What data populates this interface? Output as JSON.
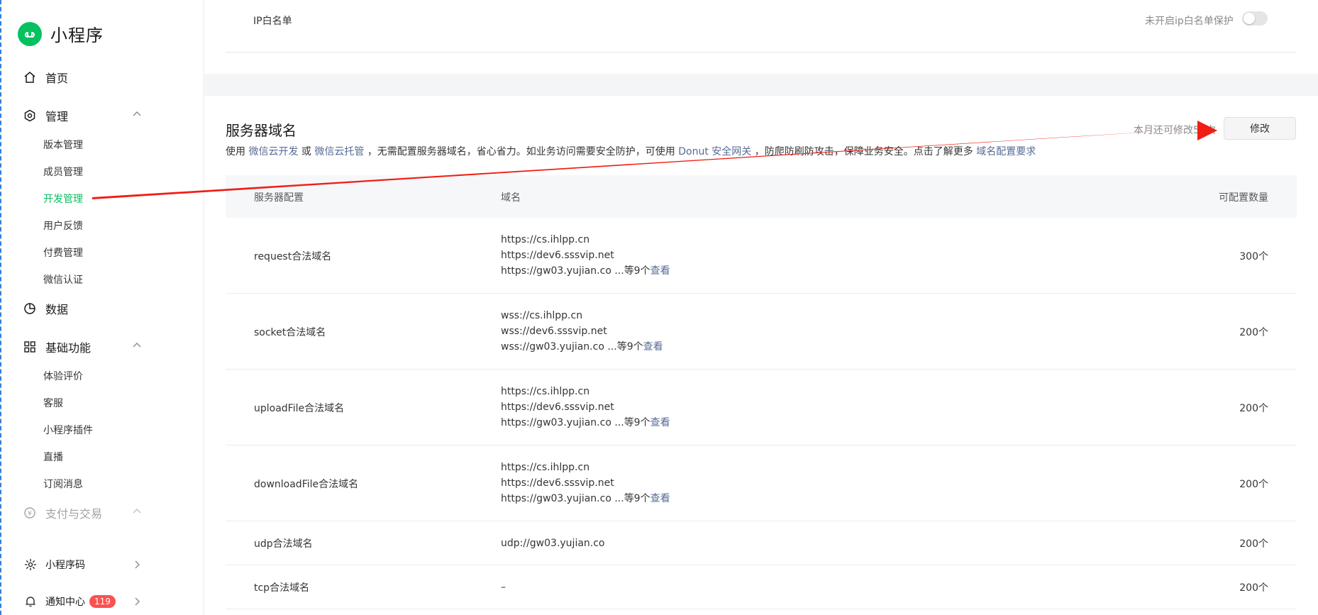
{
  "app": {
    "title": "小程序"
  },
  "sidebar": {
    "home": "首页",
    "manage": {
      "label": "管理",
      "items": [
        {
          "label": "版本管理",
          "active": false
        },
        {
          "label": "成员管理",
          "active": false
        },
        {
          "label": "开发管理",
          "active": true
        },
        {
          "label": "用户反馈",
          "active": false
        },
        {
          "label": "付费管理",
          "active": false
        },
        {
          "label": "微信认证",
          "active": false
        }
      ]
    },
    "data": "数据",
    "basic": {
      "label": "基础功能",
      "items": [
        {
          "label": "体验评价"
        },
        {
          "label": "客服"
        },
        {
          "label": "小程序插件"
        },
        {
          "label": "直播"
        },
        {
          "label": "订阅消息"
        }
      ]
    },
    "payment": "支付与交易",
    "qrcode": "小程序码",
    "notify": {
      "label": "通知中心",
      "badge": "119"
    }
  },
  "ip_whitelist": {
    "label": "IP白名单",
    "status": "未开启ip白名单保护",
    "enabled": false
  },
  "server_domain": {
    "title": "服务器域名",
    "desc": {
      "t1": "使用",
      "link1": "微信云开发",
      "t2": "或",
      "link2": "微信云托管",
      "t3": "，无需配置服务器域名，省心省力。如业务访问需要安全防护，可使用",
      "link3": "Donut 安全网关",
      "t4": "，防爬防刷防攻击，保障业务安全。点击了解更多",
      "link4": "域名配置要求"
    },
    "remain": "本月还可修改50次",
    "edit_label": "修改",
    "columns": [
      "服务器配置",
      "域名",
      "可配置数量"
    ],
    "rows": [
      {
        "name": "request合法域名",
        "domains": [
          "https://cs.ihlpp.cn",
          "https://dev6.sssvip.net"
        ],
        "last": "https://gw03.yujian.co ...等9个",
        "view": "查看",
        "count": "300个"
      },
      {
        "name": "socket合法域名",
        "domains": [
          "wss://cs.ihlpp.cn",
          "wss://dev6.sssvip.net"
        ],
        "last": "wss://gw03.yujian.co ...等9个",
        "view": "查看",
        "count": "200个"
      },
      {
        "name": "uploadFile合法域名",
        "domains": [
          "https://cs.ihlpp.cn",
          "https://dev6.sssvip.net"
        ],
        "last": "https://gw03.yujian.co ...等9个",
        "view": "查看",
        "count": "200个"
      },
      {
        "name": "downloadFile合法域名",
        "domains": [
          "https://cs.ihlpp.cn",
          "https://dev6.sssvip.net"
        ],
        "last": "https://gw03.yujian.co ...等9个",
        "view": "查看",
        "count": "200个"
      },
      {
        "name": "udp合法域名",
        "domains": [],
        "last": "udp://gw03.yujian.co",
        "view": "",
        "count": "200个"
      },
      {
        "name": "tcp合法域名",
        "domains": [],
        "last": "–",
        "view": "",
        "count": "200个"
      }
    ]
  },
  "colors": {
    "brand": "#07c160",
    "link": "#576b95",
    "badge": "#fa5151",
    "annotation_arrow": "#f01e14"
  }
}
